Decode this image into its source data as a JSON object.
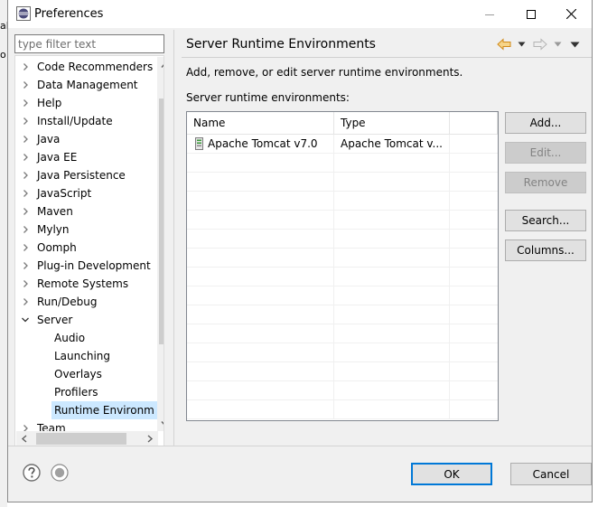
{
  "window": {
    "title": "Preferences"
  },
  "background_fragments": [
    "al",
    "o"
  ],
  "filter": {
    "placeholder": "type filter text",
    "value": ""
  },
  "tree": {
    "items": [
      {
        "label": "Code Recommenders",
        "expandable": true,
        "expanded": false,
        "level": 0
      },
      {
        "label": "Data Management",
        "expandable": true,
        "expanded": false,
        "level": 0
      },
      {
        "label": "Help",
        "expandable": true,
        "expanded": false,
        "level": 0
      },
      {
        "label": "Install/Update",
        "expandable": true,
        "expanded": false,
        "level": 0
      },
      {
        "label": "Java",
        "expandable": true,
        "expanded": false,
        "level": 0
      },
      {
        "label": "Java EE",
        "expandable": true,
        "expanded": false,
        "level": 0
      },
      {
        "label": "Java Persistence",
        "expandable": true,
        "expanded": false,
        "level": 0
      },
      {
        "label": "JavaScript",
        "expandable": true,
        "expanded": false,
        "level": 0
      },
      {
        "label": "Maven",
        "expandable": true,
        "expanded": false,
        "level": 0
      },
      {
        "label": "Mylyn",
        "expandable": true,
        "expanded": false,
        "level": 0
      },
      {
        "label": "Oomph",
        "expandable": true,
        "expanded": false,
        "level": 0
      },
      {
        "label": "Plug-in Development",
        "expandable": true,
        "expanded": false,
        "level": 0
      },
      {
        "label": "Remote Systems",
        "expandable": true,
        "expanded": false,
        "level": 0
      },
      {
        "label": "Run/Debug",
        "expandable": true,
        "expanded": false,
        "level": 0
      },
      {
        "label": "Server",
        "expandable": true,
        "expanded": true,
        "level": 0
      },
      {
        "label": "Audio",
        "expandable": false,
        "expanded": false,
        "level": 1
      },
      {
        "label": "Launching",
        "expandable": false,
        "expanded": false,
        "level": 1
      },
      {
        "label": "Overlays",
        "expandable": false,
        "expanded": false,
        "level": 1
      },
      {
        "label": "Profilers",
        "expandable": false,
        "expanded": false,
        "level": 1
      },
      {
        "label": "Runtime Environm",
        "expandable": false,
        "expanded": false,
        "level": 1,
        "selected": true
      },
      {
        "label": "Team",
        "expandable": true,
        "expanded": false,
        "level": 0
      }
    ]
  },
  "page": {
    "title": "Server Runtime Environments",
    "description": "Add, remove, or edit server runtime environments.",
    "table_label": "Server runtime environments:"
  },
  "table": {
    "columns": [
      "Name",
      "Type"
    ],
    "rows": [
      {
        "name": "Apache Tomcat v7.0",
        "type": "Apache Tomcat v..."
      }
    ],
    "empty_rows": 14
  },
  "buttons": {
    "add": "Add...",
    "edit": "Edit...",
    "remove": "Remove",
    "search": "Search...",
    "columns": "Columns..."
  },
  "footer": {
    "ok": "OK",
    "cancel": "Cancel"
  },
  "colors": {
    "selection": "#cce8ff",
    "default_button_border": "#0078d7",
    "nav_arrow": "#e8a33c"
  }
}
